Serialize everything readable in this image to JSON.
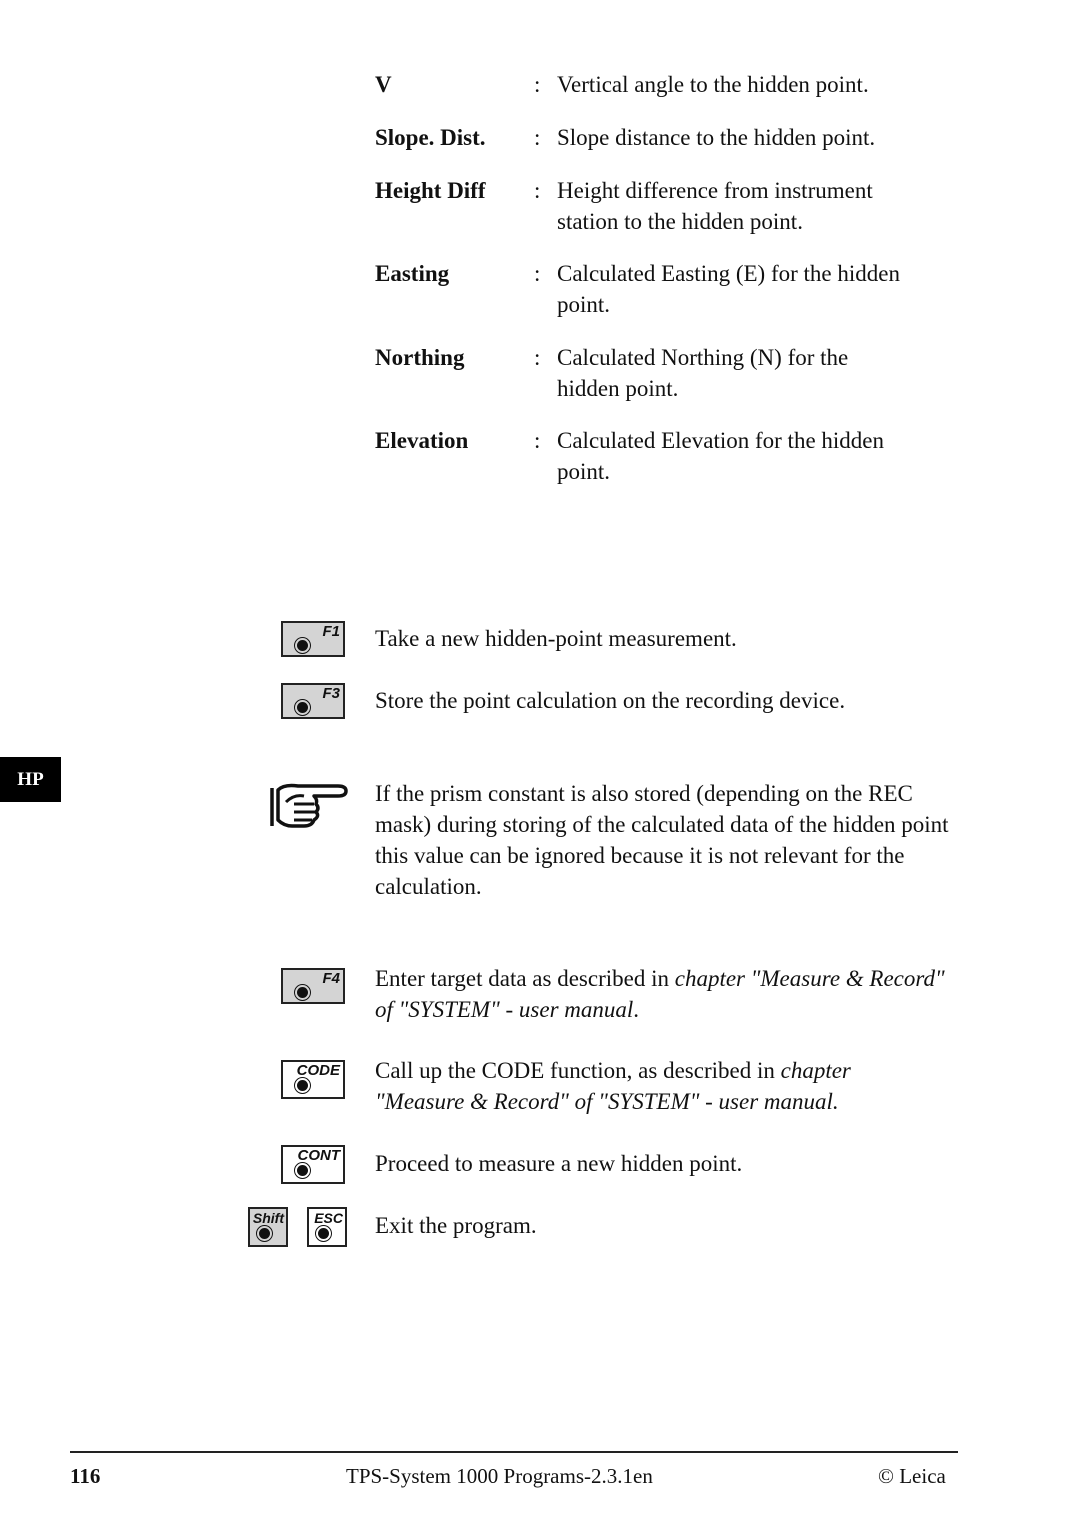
{
  "definitions": [
    {
      "term": "V",
      "colon": ":",
      "desc": "Vertical angle to the hidden point."
    },
    {
      "term": "Slope. Dist.",
      "colon": ":",
      "desc": "Slope distance to the hidden point."
    },
    {
      "term": "Height Diff",
      "colon": ":",
      "desc": "Height difference from instrument station to the hidden point."
    },
    {
      "term": "Easting",
      "colon": ":",
      "desc": "Calculated Easting (E) for the hidden point."
    },
    {
      "term": "Northing",
      "colon": ":",
      "desc": "Calculated Northing (N) for the hidden point."
    },
    {
      "term": "Elevation",
      "colon": ":",
      "desc": "Calculated Elevation for the hidden point."
    }
  ],
  "keys": {
    "f1": {
      "label": "F1",
      "icon": "function-key-icon",
      "text": "Take a new hidden-point measurement."
    },
    "f3": {
      "label": "F3",
      "icon": "function-key-icon",
      "text": "Store the point calculation on the recording device."
    },
    "f4": {
      "label": "F4",
      "icon": "function-key-icon",
      "text_plain": "Enter target data as described in ",
      "text_italic": "chapter \"Measure & Record\" of \"SYSTEM\" - user manual",
      "text_end": "."
    },
    "code": {
      "label": "CODE",
      "icon": "code-key-icon",
      "text_plain": "Call up the CODE function, as described in ",
      "text_italic": "chapter \"Measure & Record\" of \"SYSTEM\" - user manual.",
      "text_end": ""
    },
    "cont": {
      "label": "CONT",
      "icon": "cont-key-icon",
      "text": "Proceed to measure a new hidden point."
    },
    "shift": {
      "label": "Shift",
      "icon": "shift-key-icon"
    },
    "esc": {
      "label": "ESC",
      "icon": "esc-key-icon",
      "text": "Exit the program."
    }
  },
  "note": {
    "icon": "pointing-hand-icon",
    "text": "If the prism constant is also stored (depending on the REC mask) during storing of the calculated data of the hidden point this value can be ignored because it is not relevant for the calculation."
  },
  "side_tab": {
    "label": "HP"
  },
  "footer": {
    "page_number": "116",
    "title": "TPS-System 1000 Programs-2.3.1en",
    "copyright": "© Leica"
  }
}
